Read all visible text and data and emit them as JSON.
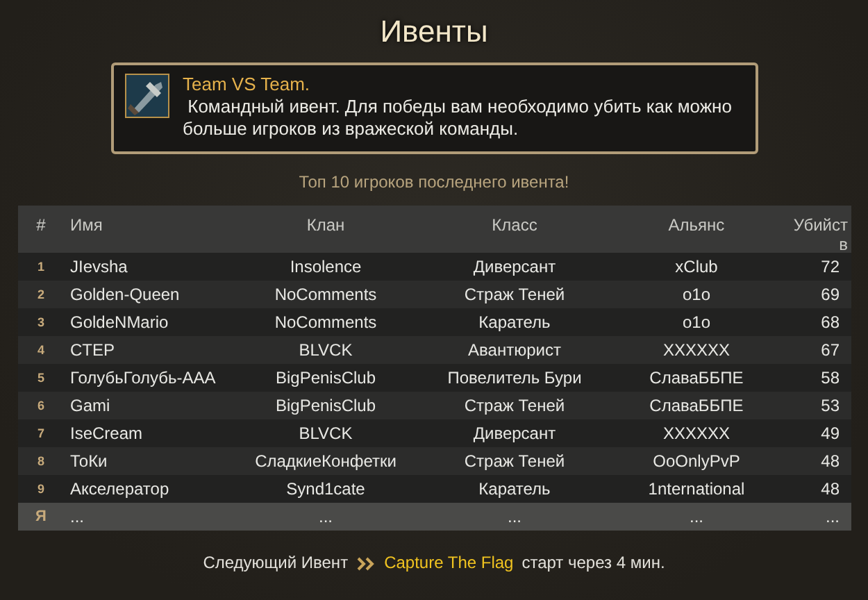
{
  "title": "Ивенты",
  "event": {
    "name": "Team VS Team.",
    "description": " Командный ивент. Для победы вам необходимо убить как можно больше игроков из вражеской команды."
  },
  "subtitle": "Топ 10 игроков последнего ивента!",
  "table": {
    "columns": [
      "#",
      "Имя",
      "Клан",
      "Класс",
      "Альянс",
      "Убийств"
    ],
    "rows": [
      {
        "rank": "1",
        "name": "JIevsha",
        "clan": "Insolence",
        "class": "Диверсант",
        "alliance": "xClub",
        "kills": "72",
        "selected": false
      },
      {
        "rank": "2",
        "name": "Golden-Queen",
        "clan": "NoComments",
        "class": "Страж Теней",
        "alliance": "o1o",
        "kills": "69",
        "selected": false
      },
      {
        "rank": "3",
        "name": "GoldeNMario",
        "clan": "NoComments",
        "class": "Каратель",
        "alliance": "o1o",
        "kills": "68",
        "selected": false
      },
      {
        "rank": "4",
        "name": "CTEP",
        "clan": "BLVCK",
        "class": "Авантюрист",
        "alliance": "XXXXXX",
        "kills": "67",
        "selected": false
      },
      {
        "rank": "5",
        "name": "ГолубьГолубь-AAA",
        "clan": "BigPenisClub",
        "class": "Повелитель Бури",
        "alliance": "СлаваББПЕ",
        "kills": "58",
        "selected": false
      },
      {
        "rank": "6",
        "name": "Gami",
        "clan": "BigPenisClub",
        "class": "Страж Теней",
        "alliance": "СлаваББПЕ",
        "kills": "53",
        "selected": false
      },
      {
        "rank": "7",
        "name": "IseCream",
        "clan": "BLVCK",
        "class": "Диверсант",
        "alliance": "XXXXXX",
        "kills": "49",
        "selected": false
      },
      {
        "rank": "8",
        "name": "ТоКи",
        "clan": "СладкиеКонфетки",
        "class": "Страж Теней",
        "alliance": "OoOnlyPvP",
        "kills": "48",
        "selected": false
      },
      {
        "rank": "9",
        "name": "Акселератор",
        "clan": "Synd1cate",
        "class": "Каратель",
        "alliance": "1nternational",
        "kills": "48",
        "selected": false
      },
      {
        "rank": "Я",
        "name": "...",
        "clan": "...",
        "class": "...",
        "alliance": "...",
        "kills": "...",
        "selected": true
      }
    ]
  },
  "footer": {
    "label": "Следующий Ивент",
    "event": "Capture The Flag",
    "suffix": "старт через 4 мин."
  }
}
